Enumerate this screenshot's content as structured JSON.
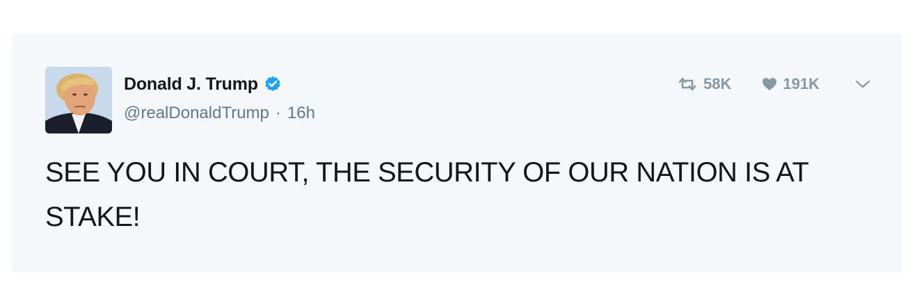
{
  "tweet": {
    "author_name": "Donald J. Trump",
    "handle": "@realDonaldTrump",
    "separator": "·",
    "timestamp": "16h",
    "text": "SEE YOU IN COURT, THE SECURITY OF OUR NATION IS AT STAKE!",
    "verified": true,
    "retweet_count": "58K",
    "like_count": "191K"
  },
  "icons": {
    "verified": "verified-badge-icon",
    "retweet": "retweet-icon",
    "like": "heart-icon",
    "more": "chevron-down-icon"
  },
  "colors": {
    "card_background": "#f5f8fa",
    "verified_blue": "#1da1f2",
    "secondary_text": "#657786",
    "action_gray": "#8899a6",
    "primary_text": "#14171a"
  }
}
